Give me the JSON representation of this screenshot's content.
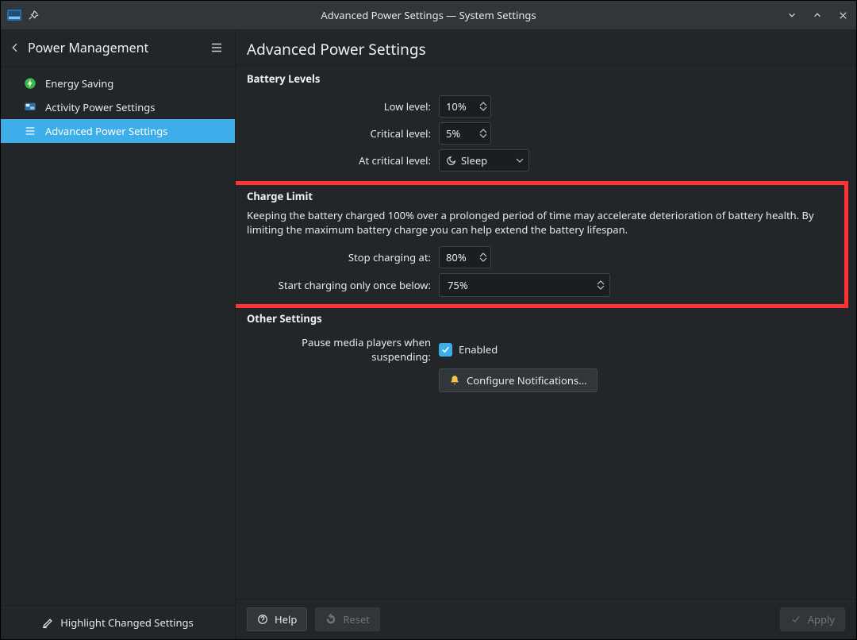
{
  "window": {
    "title": "Advanced Power Settings — System Settings"
  },
  "sidebar": {
    "header": "Power Management",
    "items": [
      {
        "label": "Energy Saving"
      },
      {
        "label": "Activity Power Settings"
      },
      {
        "label": "Advanced Power Settings"
      }
    ],
    "footer": {
      "highlight_label": "Highlight Changed Settings"
    }
  },
  "main": {
    "title": "Advanced Power Settings",
    "battery_levels": {
      "title": "Battery Levels",
      "low_label": "Low level:",
      "low_value": "10%",
      "critical_label": "Critical level:",
      "critical_value": "5%",
      "at_critical_label": "At critical level:",
      "at_critical_value": "Sleep"
    },
    "charge_limit": {
      "title": "Charge Limit",
      "description": "Keeping the battery charged 100% over a prolonged period of time may accelerate deterioration of battery health. By limiting the maximum battery charge you can help extend the battery lifespan.",
      "stop_label": "Stop charging at:",
      "stop_value": "80%",
      "start_label": "Start charging only once below:",
      "start_value": "75%"
    },
    "other": {
      "title": "Other Settings",
      "pause_label": "Pause media players when suspending:",
      "pause_checked_label": "Enabled",
      "configure_label": "Configure Notifications..."
    },
    "footer": {
      "help": "Help",
      "reset": "Reset",
      "apply": "Apply"
    }
  }
}
